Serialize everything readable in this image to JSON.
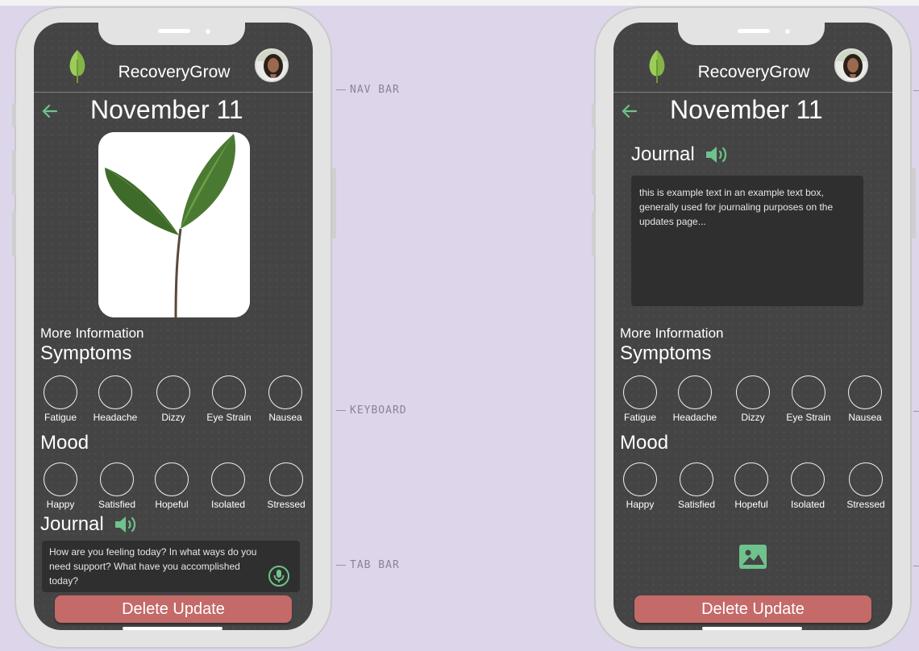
{
  "annotations": {
    "nav_bar": "NAV BAR",
    "keyboard": "KEYBOARD",
    "tab_bar": "TAB BAR"
  },
  "colors": {
    "canvas": "#ddd5ea",
    "screen_bg": "#444444",
    "accent_green": "#6fc28c",
    "delete_button": "#c46a69",
    "text_box": "#2f2f2f"
  },
  "phones": [
    {
      "app_title": "RecoveryGrow",
      "date": "November 11",
      "more_info": "More Information",
      "symptoms_heading": "Symptoms",
      "symptoms": [
        "Fatigue",
        "Headache",
        "Dizzy",
        "Eye Strain",
        "Nausea"
      ],
      "mood_heading": "Mood",
      "moods": [
        "Happy",
        "Satisfied",
        "Hopeful",
        "Isolated",
        "Stressed"
      ],
      "journal_heading": "Journal",
      "journal_placeholder": "How are you feeling today? In what ways do you need support? What have you accomplished today?",
      "delete_label": "Delete Update",
      "icons": [
        "leaf-logo-icon",
        "avatar-photo",
        "back-arrow-icon",
        "speaker-icon",
        "microphone-icon"
      ]
    },
    {
      "app_title": "RecoveryGrow",
      "date": "November 11",
      "journal_heading": "Journal",
      "journal_text": "this is example text in an example text box, generally used for journaling purposes on the updates page...",
      "more_info": "More Information",
      "symptoms_heading": "Symptoms",
      "symptoms": [
        "Fatigue",
        "Headache",
        "Dizzy",
        "Eye Strain",
        "Nausea"
      ],
      "mood_heading": "Mood",
      "moods": [
        "Happy",
        "Satisfied",
        "Hopeful",
        "Isolated",
        "Stressed"
      ],
      "delete_label": "Delete Update",
      "icons": [
        "leaf-logo-icon",
        "avatar-photo",
        "back-arrow-icon",
        "speaker-icon",
        "image-icon"
      ]
    }
  ]
}
